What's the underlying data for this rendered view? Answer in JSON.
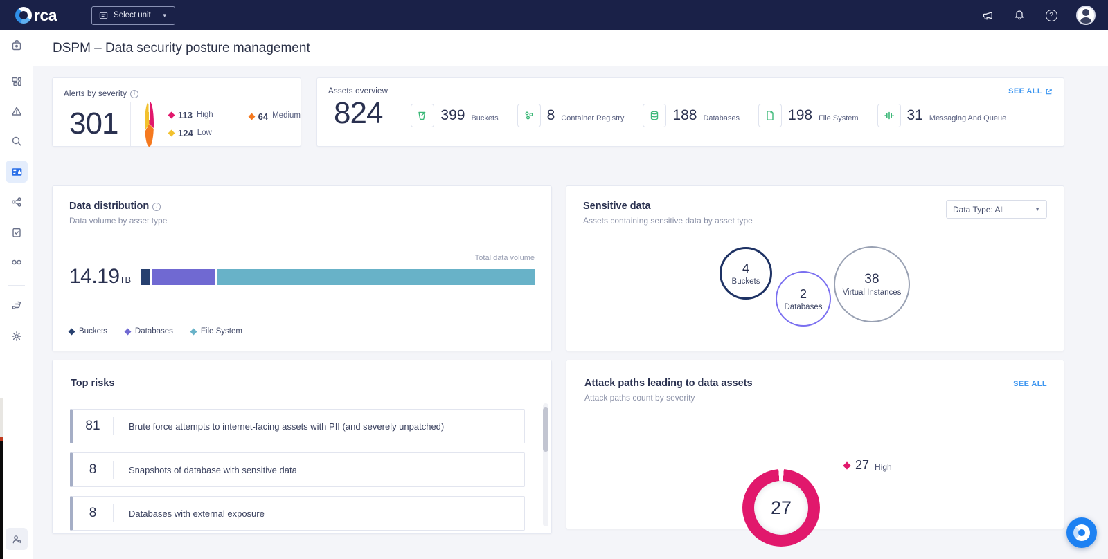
{
  "navbar": {
    "brand": "orca",
    "brand_suffix": "rca",
    "unit_selector_label": "Select unit"
  },
  "sidebar": {
    "items": [
      "home",
      "dashboards",
      "alerts",
      "discovery",
      "dspm",
      "attack-paths",
      "compliance",
      "shift-left",
      "automation",
      "settings",
      "feedback"
    ],
    "active_item": "dspm"
  },
  "page": {
    "title": "DSPM – Data security posture management"
  },
  "alerts_by_severity": {
    "title": "Alerts by severity",
    "total": "301",
    "gap_deg": 5,
    "segments": [
      {
        "count": "113",
        "label": "High",
        "color": "#E1186C"
      },
      {
        "count": "64",
        "label": "Medium",
        "color": "#F5791F"
      },
      {
        "count": "124",
        "label": "Low",
        "color": "#F2C12E"
      }
    ]
  },
  "assets_overview": {
    "title": "Assets overview",
    "see_all": "SEE ALL",
    "total": "824",
    "items": [
      {
        "count": "399",
        "label": "Buckets"
      },
      {
        "count": "8",
        "label": "Container Registry"
      },
      {
        "count": "188",
        "label": "Databases"
      },
      {
        "count": "198",
        "label": "File System"
      },
      {
        "count": "31",
        "label": "Messaging And Queue"
      }
    ]
  },
  "data_distribution": {
    "title": "Data distribution",
    "subtitle": "Data volume by asset type",
    "total_label": "Total data volume",
    "total_value": "14.19",
    "total_unit": "TB",
    "segments": [
      {
        "label": "Buckets",
        "percent": 2.2,
        "color": "#27406F"
      },
      {
        "label": "Databases",
        "percent": 16.3,
        "color": "#7069D2"
      },
      {
        "label": "File System",
        "percent": 81.5,
        "color": "#68B2C8"
      }
    ]
  },
  "sensitive_data": {
    "title": "Sensitive data",
    "subtitle": "Assets containing sensitive data by asset type",
    "filter_value": "Data Type: All",
    "bubbles": [
      {
        "count": "4",
        "label": "Buckets",
        "color": "#1E3264"
      },
      {
        "count": "2",
        "label": "Databases",
        "color": "#7A6FF0"
      },
      {
        "count": "38",
        "label": "Virtual Instances",
        "color": "#99A1B3"
      }
    ]
  },
  "top_risks": {
    "title": "Top risks",
    "rows": [
      {
        "count": "81",
        "text": "Brute force attempts to internet-facing assets with PII (and severely unpatched)"
      },
      {
        "count": "8",
        "text": "Snapshots of database with sensitive data"
      },
      {
        "count": "8",
        "text": "Databases with external exposure"
      }
    ]
  },
  "attack_paths": {
    "title": "Attack paths leading to data assets",
    "subtitle": "Attack paths count by severity",
    "see_all": "SEE ALL",
    "total": "27",
    "gap_deg": 8,
    "segments": [
      {
        "count": "27",
        "label": "High",
        "color": "#E1186C"
      }
    ]
  },
  "chart_data": [
    {
      "type": "pie",
      "title": "Alerts by severity",
      "categories": [
        "High",
        "Medium",
        "Low"
      ],
      "values": [
        113,
        64,
        124
      ],
      "colors": [
        "#E1186C",
        "#F5791F",
        "#F2C12E"
      ],
      "total": 301,
      "legend_position": "right"
    },
    {
      "type": "bar",
      "title": "Data distribution - Data volume by asset type",
      "categories": [
        "Buckets",
        "Databases",
        "File System"
      ],
      "values_percent": [
        2.2,
        16.3,
        81.5
      ],
      "total_volume": "14.19 TB",
      "colors": [
        "#27406F",
        "#7069D2",
        "#68B2C8"
      ],
      "orientation": "horizontal-stacked"
    },
    {
      "type": "scatter",
      "title": "Sensitive data - Assets containing sensitive data by asset type",
      "categories": [
        "Buckets",
        "Databases",
        "Virtual Instances"
      ],
      "values": [
        4,
        2,
        38
      ],
      "representation": "bubble"
    },
    {
      "type": "pie",
      "title": "Attack paths leading to data assets",
      "categories": [
        "High"
      ],
      "values": [
        27
      ],
      "colors": [
        "#E1186C"
      ],
      "total": 27,
      "legend_position": "right"
    }
  ]
}
